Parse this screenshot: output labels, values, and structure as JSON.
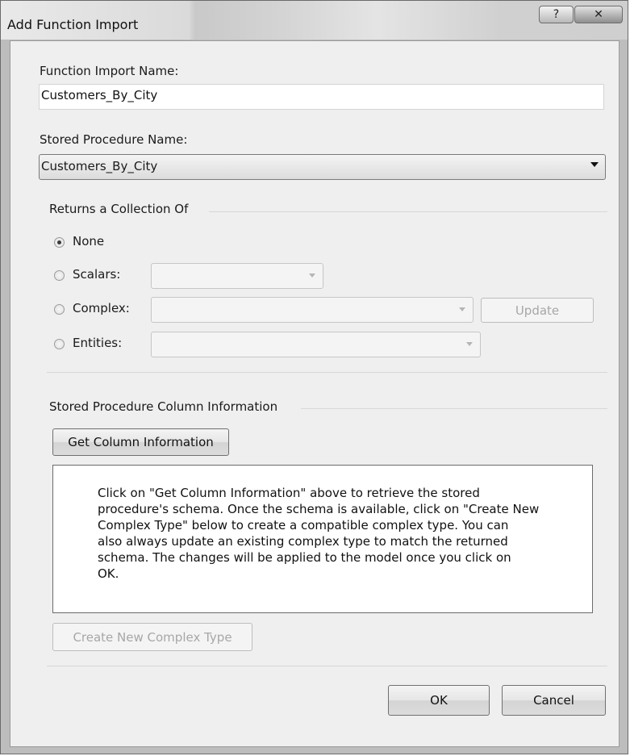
{
  "window": {
    "title": "Add Function Import",
    "help_glyph": "?",
    "close_glyph": "✕"
  },
  "function_import": {
    "label": "Function Import Name:",
    "value": "Customers_By_City"
  },
  "stored_procedure": {
    "label": "Stored Procedure Name:",
    "selected": "Customers_By_City"
  },
  "returns": {
    "group_label": "Returns a Collection Of",
    "options": {
      "none": {
        "label": "None",
        "selected": true
      },
      "scalars": {
        "label": "Scalars:",
        "selected": false
      },
      "complex": {
        "label": "Complex:",
        "selected": false
      },
      "entities": {
        "label": "Entities:",
        "selected": false
      }
    },
    "update_label": "Update"
  },
  "column_info": {
    "group_label": "Stored Procedure Column Information",
    "get_button": "Get Column Information",
    "info_lines": [
      "Click on \"Get Column Information\" above to retrieve the stored",
      "procedure's schema. Once the schema is available, click on \"Create New",
      "Complex Type\" below to create a compatible complex type. You can",
      "also always update an existing complex type to match the returned",
      "schema. The changes will be applied to the model once you click on",
      "OK."
    ],
    "create_button": "Create New Complex Type"
  },
  "footer": {
    "ok_label": "OK",
    "cancel_label": "Cancel"
  }
}
